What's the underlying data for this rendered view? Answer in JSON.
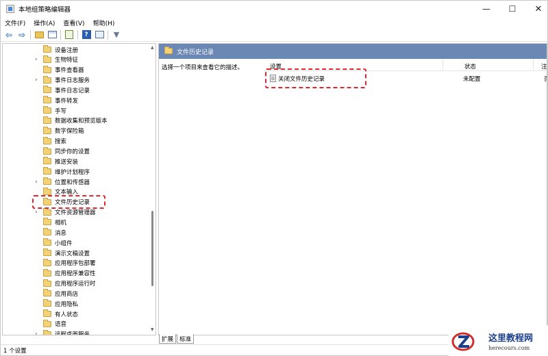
{
  "window": {
    "title": "本地组策略编辑器",
    "controls": {
      "minimize": "—",
      "maximize": "☐",
      "close": "✕"
    }
  },
  "menu": [
    "文件(F)",
    "操作(A)",
    "查看(V)",
    "帮助(H)"
  ],
  "toolbar": {
    "icons": [
      "back-arrow-icon",
      "forward-arrow-icon",
      "up-folder-icon",
      "show-hide-tree-icon",
      "export-list-icon",
      "help-icon",
      "properties-icon",
      "filter-icon"
    ],
    "back_glyph": "⇦",
    "forward_glyph": "⇨",
    "help_glyph": "?",
    "filter_glyph": "▼"
  },
  "tree": {
    "items": [
      {
        "label": "设备注册",
        "expandable": false
      },
      {
        "label": "生物特征",
        "expandable": true
      },
      {
        "label": "事件查看器",
        "expandable": false
      },
      {
        "label": "事件日志服务",
        "expandable": true
      },
      {
        "label": "事件日志记录",
        "expandable": false
      },
      {
        "label": "事件转发",
        "expandable": false
      },
      {
        "label": "手写",
        "expandable": false
      },
      {
        "label": "数据收集和预览版本",
        "expandable": false
      },
      {
        "label": "数字保险箱",
        "expandable": false
      },
      {
        "label": "搜索",
        "expandable": false
      },
      {
        "label": "同步你的设置",
        "expandable": false
      },
      {
        "label": "推送安装",
        "expandable": false
      },
      {
        "label": "维护计划程序",
        "expandable": false
      },
      {
        "label": "位置和传感器",
        "expandable": true
      },
      {
        "label": "文本输入",
        "expandable": false
      },
      {
        "label": "文件历史记录",
        "expandable": false,
        "selected": true
      },
      {
        "label": "文件资源管理器",
        "expandable": true
      },
      {
        "label": "相机",
        "expandable": false
      },
      {
        "label": "消息",
        "expandable": false
      },
      {
        "label": "小组件",
        "expandable": false
      },
      {
        "label": "演示文稿设置",
        "expandable": false
      },
      {
        "label": "应用程序包部署",
        "expandable": false
      },
      {
        "label": "应用程序兼容性",
        "expandable": false
      },
      {
        "label": "应用程序运行时",
        "expandable": false
      },
      {
        "label": "应用商店",
        "expandable": false
      },
      {
        "label": "应用隐私",
        "expandable": false
      },
      {
        "label": "有人状态",
        "expandable": false
      },
      {
        "label": "语音",
        "expandable": false
      },
      {
        "label": "远程桌面服务",
        "expandable": true
      }
    ]
  },
  "right_pane": {
    "header_title": "文件历史记录",
    "description": "选择一个项目来查看它的描述。",
    "columns": {
      "setting": "设置",
      "state": "状态",
      "note": "注"
    },
    "rows": [
      {
        "setting": "关闭文件历史记录",
        "state": "未配置",
        "note": "否"
      }
    ]
  },
  "tabs": [
    "扩展",
    "标准"
  ],
  "status": "1 个设置",
  "watermark": {
    "title": "这里教程网",
    "url": "herecours.com"
  },
  "colors": {
    "header_bg": "#6b87b3",
    "highlight": "#e0262a",
    "folder": "#f3d277"
  }
}
